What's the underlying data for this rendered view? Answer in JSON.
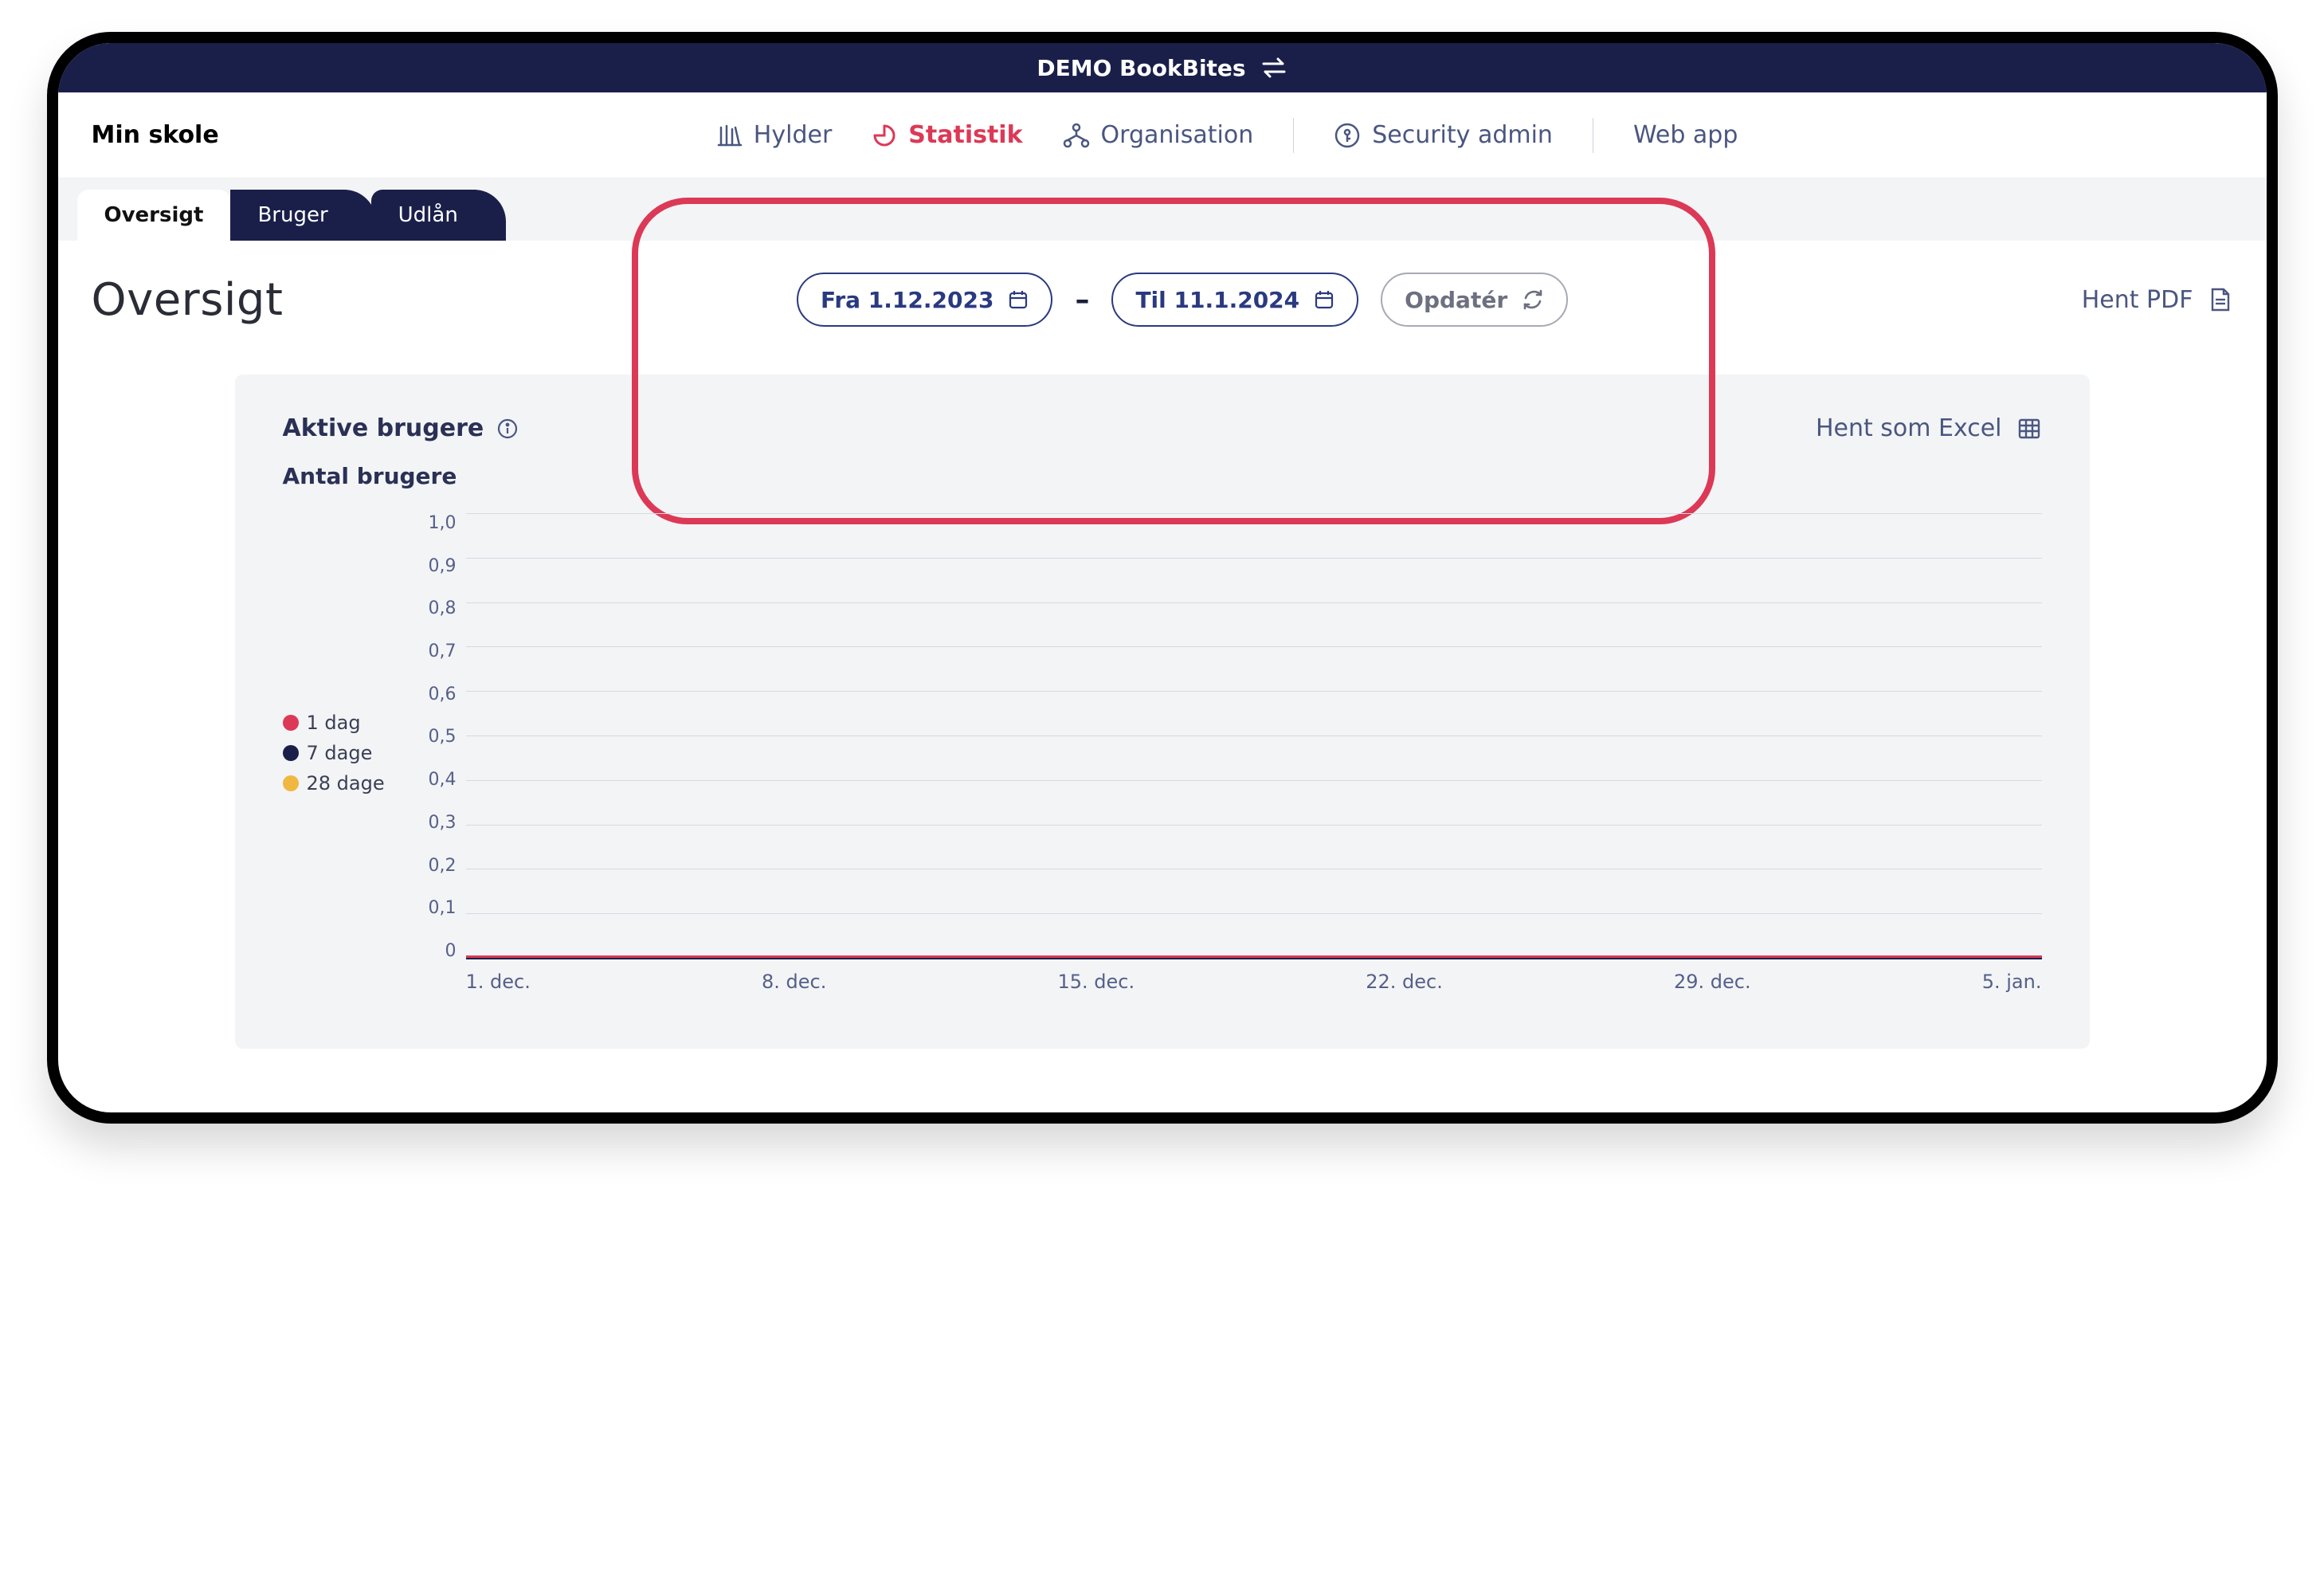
{
  "topbar": {
    "title": "DEMO BookBites"
  },
  "brand": "Min skole",
  "nav": {
    "items": [
      {
        "label": "Hylder",
        "active": false
      },
      {
        "label": "Statistik",
        "active": true
      },
      {
        "label": "Organisation",
        "active": false
      },
      {
        "label": "Security admin",
        "active": false
      },
      {
        "label": "Web app",
        "active": false
      }
    ]
  },
  "tabs": [
    {
      "label": "Oversigt",
      "active": true
    },
    {
      "label": "Bruger",
      "active": false
    },
    {
      "label": "Udlån",
      "active": false
    }
  ],
  "page_title": "Oversigt",
  "date": {
    "from_label": "Fra 1.12.2023",
    "to_label": "Til 11.1.2024",
    "update_label": "Opdatér",
    "separator": "–"
  },
  "pdf_label": "Hent PDF",
  "panel": {
    "title": "Aktive brugere",
    "subtitle": "Antal brugere",
    "excel_label": "Hent som Excel"
  },
  "legend": [
    {
      "label": "1 dag",
      "color": "#dc3956"
    },
    {
      "label": "7 dage",
      "color": "#1a1f4a"
    },
    {
      "label": "28 dage",
      "color": "#f0b840"
    }
  ],
  "chart_data": {
    "type": "line",
    "xlabel": "",
    "ylabel": "",
    "ylim": [
      0,
      1.0
    ],
    "y_ticks": [
      "1,0",
      "0,9",
      "0,8",
      "0,7",
      "0,6",
      "0,5",
      "0,4",
      "0,3",
      "0,2",
      "0,1",
      "0"
    ],
    "x_ticks": [
      "1. dec.",
      "8. dec.",
      "15. dec.",
      "22. dec.",
      "29. dec.",
      "5. jan."
    ],
    "categories": [
      "1. dec.",
      "8. dec.",
      "15. dec.",
      "22. dec.",
      "29. dec.",
      "5. jan."
    ],
    "series": [
      {
        "name": "1 dag",
        "color": "#dc3956",
        "values": [
          0,
          0,
          0,
          0,
          0,
          0
        ]
      },
      {
        "name": "7 dage",
        "color": "#1a1f4a",
        "values": [
          0,
          0,
          0,
          0,
          0,
          0
        ]
      },
      {
        "name": "28 dage",
        "color": "#f0b840",
        "values": [
          0,
          0,
          0,
          0,
          0,
          0
        ]
      }
    ]
  }
}
